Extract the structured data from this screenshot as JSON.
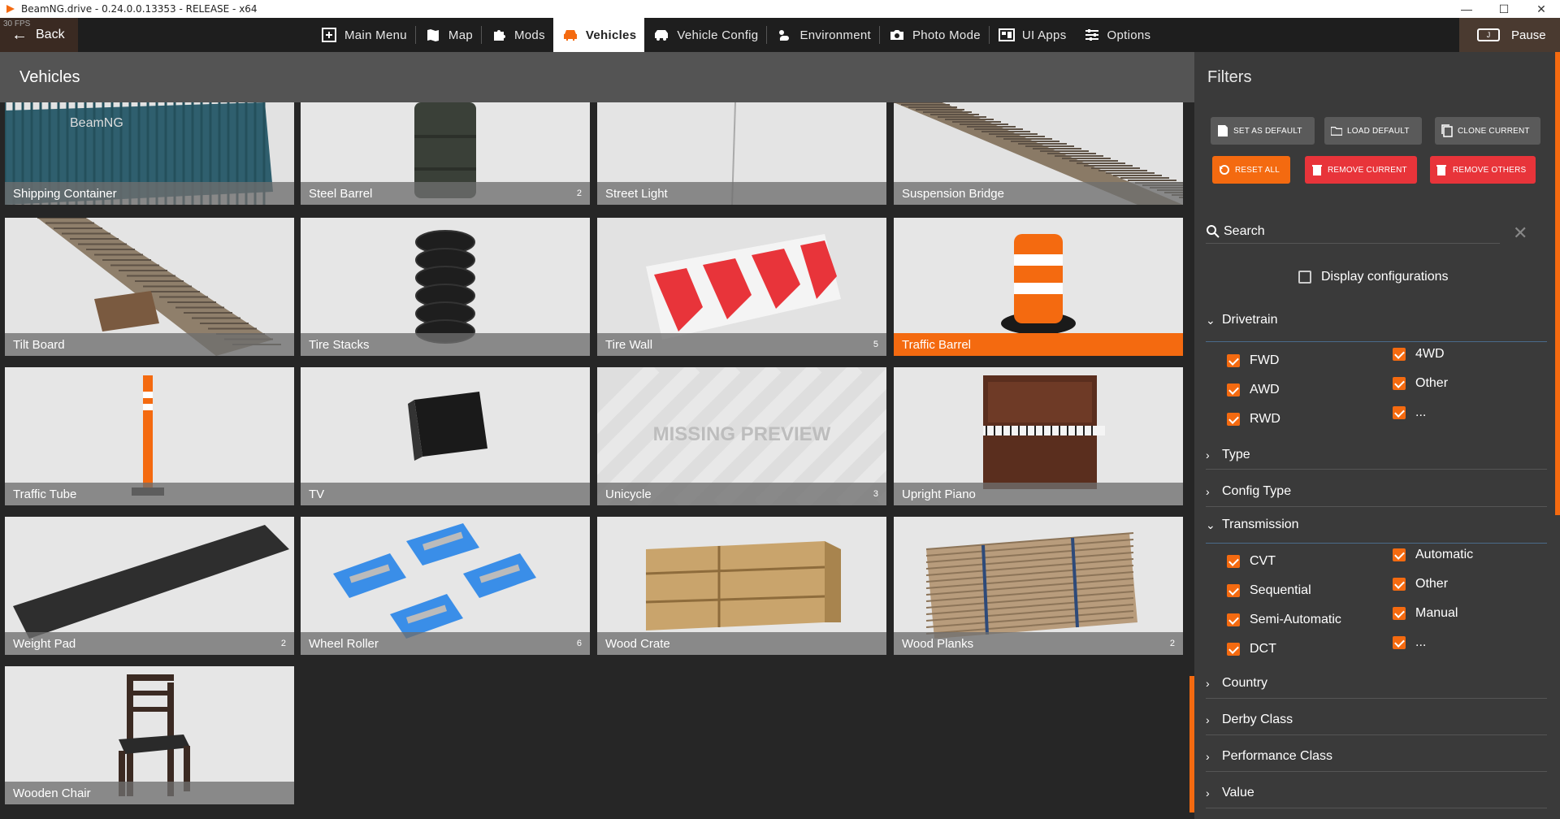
{
  "window": {
    "title": "BeamNG.drive - 0.24.0.0.13353 - RELEASE - x64",
    "controls": [
      "—",
      "☐",
      "✕"
    ]
  },
  "fps": "30 FPS",
  "nav": {
    "back": "Back",
    "items": [
      {
        "label": "Main Menu",
        "icon": "main-menu-icon"
      },
      {
        "label": "Map",
        "icon": "map-icon"
      },
      {
        "label": "Mods",
        "icon": "puzzle-icon"
      },
      {
        "label": "Vehicles",
        "icon": "car-icon",
        "active": true
      },
      {
        "label": "Vehicle Config",
        "icon": "vehicle-config-icon"
      },
      {
        "label": "Environment",
        "icon": "weather-icon"
      },
      {
        "label": "Photo Mode",
        "icon": "camera-icon"
      },
      {
        "label": "UI Apps",
        "icon": "ui-apps-icon"
      },
      {
        "label": "Options",
        "icon": "sliders-icon"
      }
    ],
    "pause": "Pause",
    "pause_key": "J"
  },
  "vehicles": {
    "title": "Vehicles",
    "tiles": [
      {
        "name": "Shipping Container",
        "count": ""
      },
      {
        "name": "Steel Barrel",
        "count": "2"
      },
      {
        "name": "Street Light",
        "count": ""
      },
      {
        "name": "Suspension Bridge",
        "count": ""
      },
      {
        "name": "Tilt Board",
        "count": ""
      },
      {
        "name": "Tire Stacks",
        "count": ""
      },
      {
        "name": "Tire Wall",
        "count": "5"
      },
      {
        "name": "Traffic Barrel",
        "count": "",
        "selected": true
      },
      {
        "name": "Traffic Tube",
        "count": ""
      },
      {
        "name": "TV",
        "count": ""
      },
      {
        "name": "Unicycle",
        "count": "3"
      },
      {
        "name": "Upright Piano",
        "count": ""
      },
      {
        "name": "Weight Pad",
        "count": "2"
      },
      {
        "name": "Wheel Roller",
        "count": "6"
      },
      {
        "name": "Wood Crate",
        "count": ""
      },
      {
        "name": "Wood Planks",
        "count": "2"
      },
      {
        "name": "Wooden Chair",
        "count": ""
      }
    ],
    "missing_preview": "MISSING PREVIEW",
    "container_logo": "BeamNG"
  },
  "filters": {
    "title": "Filters",
    "buttons": {
      "set_default": "SET AS DEFAULT",
      "load_default": "LOAD DEFAULT",
      "clone_current": "CLONE CURRENT",
      "reset_all": "RESET ALL",
      "remove_current": "REMOVE CURRENT",
      "remove_others": "REMOVE OTHERS"
    },
    "search_label": "Search",
    "display_configurations": "Display configurations",
    "sections": {
      "drivetrain": "Drivetrain",
      "type": "Type",
      "config_type": "Config Type",
      "transmission": "Transmission",
      "country": "Country",
      "derby_class": "Derby Class",
      "performance_class": "Performance Class",
      "value": "Value"
    },
    "drivetrain_left": [
      "FWD",
      "AWD",
      "RWD"
    ],
    "drivetrain_right": [
      "4WD",
      "Other",
      "..."
    ],
    "transmission_left": [
      "CVT",
      "Sequential",
      "Semi-Automatic",
      "DCT"
    ],
    "transmission_right": [
      "Automatic",
      "Other",
      "Manual",
      "..."
    ]
  },
  "colors": {
    "accent": "#f46a10",
    "danger": "#e8343a"
  }
}
